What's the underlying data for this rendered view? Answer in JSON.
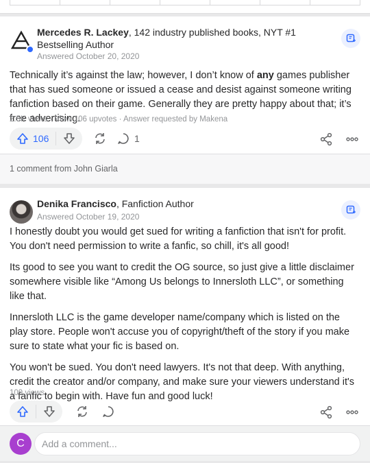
{
  "colors": {
    "accent": "#2e69ff",
    "muted": "#939598",
    "commenter_avatar": "#a83fcf"
  },
  "answers": [
    {
      "author_name": "Mercedes R. Lackey",
      "author_credential": ", 142 industry published books, NYT #1 Bestselling Author",
      "answered": "Answered October 20, 2020",
      "body_before_bold": "Technically it’s against the law; however, I don’t know of ",
      "body_bold": "any",
      "body_after_bold": " games publisher that has sued someone or issued a cease and desist against someone writing fanfiction based on their game. Generally they are pretty happy about that; it’s free advertising.",
      "meta": "2.5K views · View 106 upvotes · Answer requested by Makena",
      "upvotes": "106",
      "comment_count": "1",
      "comments_link": "1 comment from John Giarla"
    },
    {
      "author_name": "Denika Francisco",
      "author_credential": ", Fanfiction Author",
      "answered": "Answered October 19, 2020",
      "paragraphs": [
        "I honestly doubt you would get sued for writing a fanfiction that isn't for profit. You don't need permission to write a fanfic, so chill, it's all good!",
        "Its good to see you want to credit the OG source, so just give a little disclaimer somewhere visible like “Among Us belongs to Innersloth LLC”, or something like that.",
        "Innersloth LLC is the game developer name/company which is listed on the play store. People won't accuse you of copyright/theft of the story if you make sure to state what your fic is based on.",
        "You won't be sued. You don't need lawyers. It's not that deep. With anything, credit the creator and/or company, and make sure your viewers understand it's a fanfic to begin with. Have fun and good luck!"
      ],
      "meta": "109 views"
    }
  ],
  "add_comment": {
    "avatar_letter": "C",
    "placeholder": "Add a comment..."
  },
  "icons": [
    "upvote-icon",
    "downvote-icon",
    "reshare-icon",
    "comment-icon",
    "share-icon",
    "more-icon",
    "request-icon"
  ]
}
